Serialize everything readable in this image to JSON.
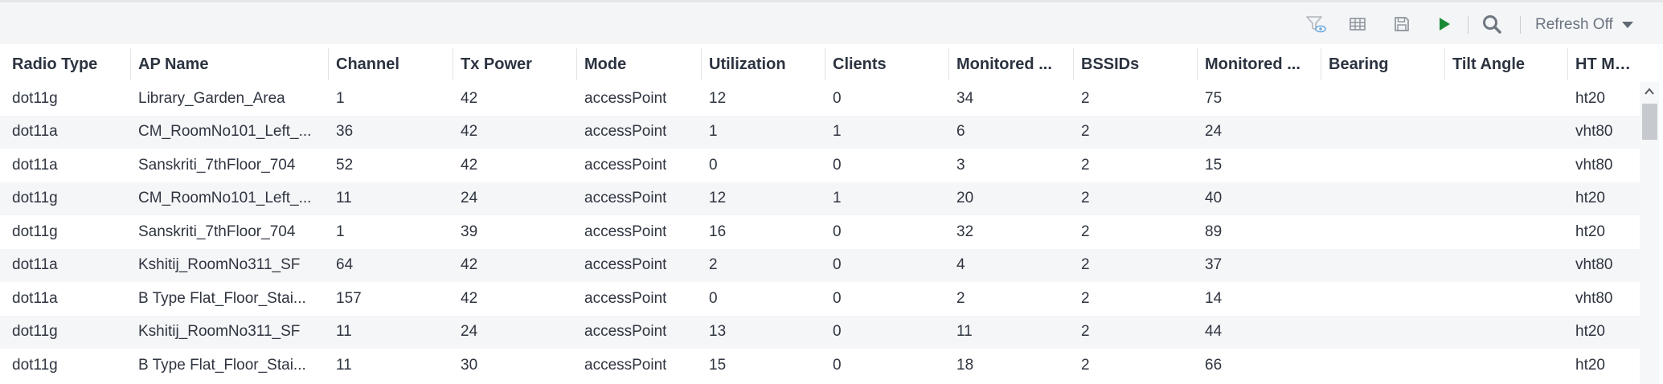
{
  "toolbar": {
    "icons": [
      "filter-show-icon",
      "columns-grid-icon",
      "save-icon",
      "run-play-icon",
      "search-icon"
    ],
    "refresh_label": "Refresh Off"
  },
  "colors": {
    "play_icon": "#1a8a35",
    "header_text": "#2c3340",
    "cell_text": "#2f3540",
    "row_alt_bg": "#f5f6f8"
  },
  "table": {
    "columns": [
      "Radio Type",
      "AP Name",
      "Channel",
      "Tx Power",
      "Mode",
      "Utilization",
      "Clients",
      "Monitored ...",
      "BSSIDs",
      "Monitored ...",
      "Bearing",
      "Tilt Angle",
      "HT Mode"
    ],
    "rows": [
      [
        "dot11g",
        "Library_Garden_Area",
        "1",
        "42",
        "accessPoint",
        "12",
        "0",
        "34",
        "2",
        "75",
        "",
        "",
        "ht20"
      ],
      [
        "dot11a",
        "CM_RoomNo101_Left_...",
        "36",
        "42",
        "accessPoint",
        "1",
        "1",
        "6",
        "2",
        "24",
        "",
        "",
        "vht80"
      ],
      [
        "dot11a",
        "Sanskriti_7thFloor_704",
        "52",
        "42",
        "accessPoint",
        "0",
        "0",
        "3",
        "2",
        "15",
        "",
        "",
        "vht80"
      ],
      [
        "dot11g",
        "CM_RoomNo101_Left_...",
        "11",
        "24",
        "accessPoint",
        "12",
        "1",
        "20",
        "2",
        "40",
        "",
        "",
        "ht20"
      ],
      [
        "dot11g",
        "Sanskriti_7thFloor_704",
        "1",
        "39",
        "accessPoint",
        "16",
        "0",
        "32",
        "2",
        "89",
        "",
        "",
        "ht20"
      ],
      [
        "dot11a",
        "Kshitij_RoomNo311_SF",
        "64",
        "42",
        "accessPoint",
        "2",
        "0",
        "4",
        "2",
        "37",
        "",
        "",
        "vht80"
      ],
      [
        "dot11a",
        "B Type Flat_Floor_Stai...",
        "157",
        "42",
        "accessPoint",
        "0",
        "0",
        "2",
        "2",
        "14",
        "",
        "",
        "vht80"
      ],
      [
        "dot11g",
        "Kshitij_RoomNo311_SF",
        "11",
        "24",
        "accessPoint",
        "13",
        "0",
        "11",
        "2",
        "44",
        "",
        "",
        "ht20"
      ],
      [
        "dot11g",
        "B Type Flat_Floor_Stai...",
        "11",
        "30",
        "accessPoint",
        "15",
        "0",
        "18",
        "2",
        "66",
        "",
        "",
        "ht20"
      ]
    ]
  }
}
